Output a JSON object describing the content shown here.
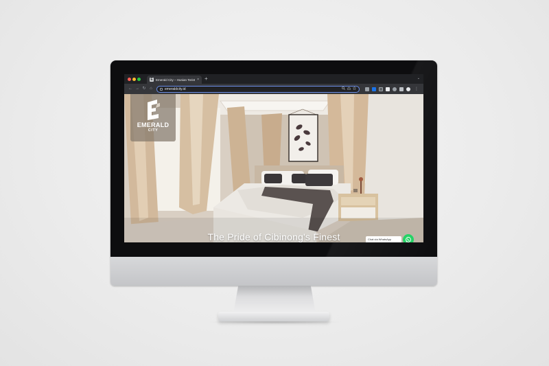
{
  "browser": {
    "tab_title": "Emerald City – Hunian Terinte",
    "tab_close": "×",
    "new_tab": "+",
    "tab_menu": "⌄",
    "url": "emeraldcity.id",
    "menu_icon": "⋮",
    "nav": {
      "back": "←",
      "forward": "→",
      "reload": "↻",
      "home": "⌂"
    },
    "omnibox_icons": [
      "search-icon",
      "share-icon",
      "star-icon"
    ],
    "extensions": [
      "ext-1",
      "ext-2",
      "ext-3",
      "ext-4",
      "ext-5",
      "ext-6",
      "profile"
    ]
  },
  "site": {
    "logo_mark": "E",
    "logo_line1": "EMERALD",
    "logo_line2": "CITY",
    "tagline": "The Pride of Cibinong's Finest",
    "chat_label": "Chat via WhatsApp",
    "chat_icon": "whatsapp-icon"
  },
  "colors": {
    "accent": "#6b8ee8",
    "whatsapp": "#25d366",
    "logo_bg": "#84786c"
  }
}
